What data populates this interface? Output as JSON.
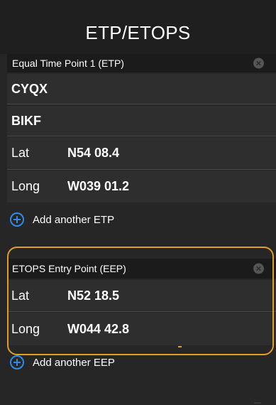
{
  "title": "ETP/ETOPS",
  "etp": {
    "header": "Equal Time Point 1 (ETP)",
    "origin": "CYQX",
    "destination": "BIKF",
    "lat_label": "Lat",
    "lat_value": "N54 08.4",
    "long_label": "Long",
    "long_value": "W039 01.2",
    "add_label": "Add another ETP"
  },
  "eep": {
    "header": "ETOPS Entry Point (EEP)",
    "lat_label": "Lat",
    "lat_value": "N52 18.5",
    "long_label": "Long",
    "long_value": "W044 42.8",
    "add_label": "Add another EEP"
  },
  "colors": {
    "accent_blue": "#2f8ce6",
    "highlight_orange": "#e09f22",
    "background": "#262626"
  },
  "icons": {
    "close": "close-icon",
    "add": "plus-circle-icon"
  }
}
